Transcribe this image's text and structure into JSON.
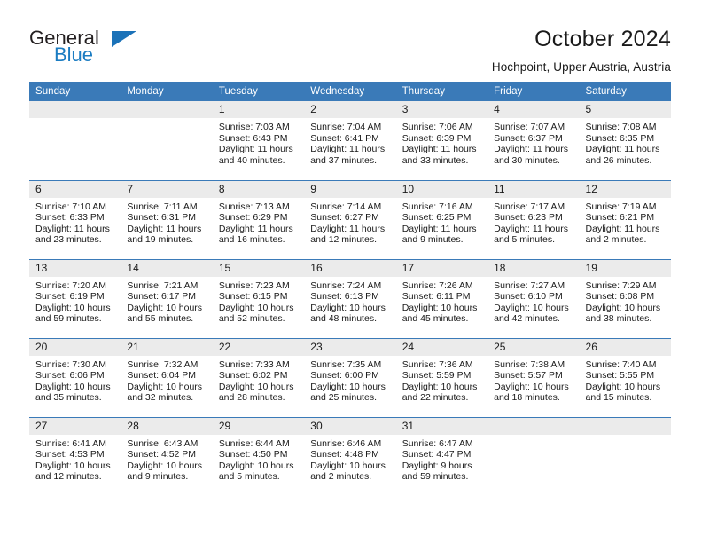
{
  "brand": {
    "word_one": "General",
    "word_two": "Blue",
    "triangle_icon": "brand-triangle-icon",
    "color_blue": "#1b7cc2",
    "color_dark": "#231f20"
  },
  "header": {
    "title": "October 2024",
    "subtitle": "Hochpoint, Upper Austria, Austria"
  },
  "theme": {
    "header_blue": "#3a7ab8",
    "daynum_gray": "#ebebeb",
    "text": "#1a1a1a"
  },
  "calendar": {
    "weekday_headers": [
      "Sunday",
      "Monday",
      "Tuesday",
      "Wednesday",
      "Thursday",
      "Friday",
      "Saturday"
    ],
    "weeks": [
      [
        {
          "day": "",
          "sunrise": "",
          "sunset": "",
          "daylight": "",
          "empty": true
        },
        {
          "day": "",
          "sunrise": "",
          "sunset": "",
          "daylight": "",
          "empty": true
        },
        {
          "day": "1",
          "sunrise": "Sunrise: 7:03 AM",
          "sunset": "Sunset: 6:43 PM",
          "daylight": "Daylight: 11 hours and 40 minutes."
        },
        {
          "day": "2",
          "sunrise": "Sunrise: 7:04 AM",
          "sunset": "Sunset: 6:41 PM",
          "daylight": "Daylight: 11 hours and 37 minutes."
        },
        {
          "day": "3",
          "sunrise": "Sunrise: 7:06 AM",
          "sunset": "Sunset: 6:39 PM",
          "daylight": "Daylight: 11 hours and 33 minutes."
        },
        {
          "day": "4",
          "sunrise": "Sunrise: 7:07 AM",
          "sunset": "Sunset: 6:37 PM",
          "daylight": "Daylight: 11 hours and 30 minutes."
        },
        {
          "day": "5",
          "sunrise": "Sunrise: 7:08 AM",
          "sunset": "Sunset: 6:35 PM",
          "daylight": "Daylight: 11 hours and 26 minutes."
        }
      ],
      [
        {
          "day": "6",
          "sunrise": "Sunrise: 7:10 AM",
          "sunset": "Sunset: 6:33 PM",
          "daylight": "Daylight: 11 hours and 23 minutes."
        },
        {
          "day": "7",
          "sunrise": "Sunrise: 7:11 AM",
          "sunset": "Sunset: 6:31 PM",
          "daylight": "Daylight: 11 hours and 19 minutes."
        },
        {
          "day": "8",
          "sunrise": "Sunrise: 7:13 AM",
          "sunset": "Sunset: 6:29 PM",
          "daylight": "Daylight: 11 hours and 16 minutes."
        },
        {
          "day": "9",
          "sunrise": "Sunrise: 7:14 AM",
          "sunset": "Sunset: 6:27 PM",
          "daylight": "Daylight: 11 hours and 12 minutes."
        },
        {
          "day": "10",
          "sunrise": "Sunrise: 7:16 AM",
          "sunset": "Sunset: 6:25 PM",
          "daylight": "Daylight: 11 hours and 9 minutes."
        },
        {
          "day": "11",
          "sunrise": "Sunrise: 7:17 AM",
          "sunset": "Sunset: 6:23 PM",
          "daylight": "Daylight: 11 hours and 5 minutes."
        },
        {
          "day": "12",
          "sunrise": "Sunrise: 7:19 AM",
          "sunset": "Sunset: 6:21 PM",
          "daylight": "Daylight: 11 hours and 2 minutes."
        }
      ],
      [
        {
          "day": "13",
          "sunrise": "Sunrise: 7:20 AM",
          "sunset": "Sunset: 6:19 PM",
          "daylight": "Daylight: 10 hours and 59 minutes."
        },
        {
          "day": "14",
          "sunrise": "Sunrise: 7:21 AM",
          "sunset": "Sunset: 6:17 PM",
          "daylight": "Daylight: 10 hours and 55 minutes."
        },
        {
          "day": "15",
          "sunrise": "Sunrise: 7:23 AM",
          "sunset": "Sunset: 6:15 PM",
          "daylight": "Daylight: 10 hours and 52 minutes."
        },
        {
          "day": "16",
          "sunrise": "Sunrise: 7:24 AM",
          "sunset": "Sunset: 6:13 PM",
          "daylight": "Daylight: 10 hours and 48 minutes."
        },
        {
          "day": "17",
          "sunrise": "Sunrise: 7:26 AM",
          "sunset": "Sunset: 6:11 PM",
          "daylight": "Daylight: 10 hours and 45 minutes."
        },
        {
          "day": "18",
          "sunrise": "Sunrise: 7:27 AM",
          "sunset": "Sunset: 6:10 PM",
          "daylight": "Daylight: 10 hours and 42 minutes."
        },
        {
          "day": "19",
          "sunrise": "Sunrise: 7:29 AM",
          "sunset": "Sunset: 6:08 PM",
          "daylight": "Daylight: 10 hours and 38 minutes."
        }
      ],
      [
        {
          "day": "20",
          "sunrise": "Sunrise: 7:30 AM",
          "sunset": "Sunset: 6:06 PM",
          "daylight": "Daylight: 10 hours and 35 minutes."
        },
        {
          "day": "21",
          "sunrise": "Sunrise: 7:32 AM",
          "sunset": "Sunset: 6:04 PM",
          "daylight": "Daylight: 10 hours and 32 minutes."
        },
        {
          "day": "22",
          "sunrise": "Sunrise: 7:33 AM",
          "sunset": "Sunset: 6:02 PM",
          "daylight": "Daylight: 10 hours and 28 minutes."
        },
        {
          "day": "23",
          "sunrise": "Sunrise: 7:35 AM",
          "sunset": "Sunset: 6:00 PM",
          "daylight": "Daylight: 10 hours and 25 minutes."
        },
        {
          "day": "24",
          "sunrise": "Sunrise: 7:36 AM",
          "sunset": "Sunset: 5:59 PM",
          "daylight": "Daylight: 10 hours and 22 minutes."
        },
        {
          "day": "25",
          "sunrise": "Sunrise: 7:38 AM",
          "sunset": "Sunset: 5:57 PM",
          "daylight": "Daylight: 10 hours and 18 minutes."
        },
        {
          "day": "26",
          "sunrise": "Sunrise: 7:40 AM",
          "sunset": "Sunset: 5:55 PM",
          "daylight": "Daylight: 10 hours and 15 minutes."
        }
      ],
      [
        {
          "day": "27",
          "sunrise": "Sunrise: 6:41 AM",
          "sunset": "Sunset: 4:53 PM",
          "daylight": "Daylight: 10 hours and 12 minutes."
        },
        {
          "day": "28",
          "sunrise": "Sunrise: 6:43 AM",
          "sunset": "Sunset: 4:52 PM",
          "daylight": "Daylight: 10 hours and 9 minutes."
        },
        {
          "day": "29",
          "sunrise": "Sunrise: 6:44 AM",
          "sunset": "Sunset: 4:50 PM",
          "daylight": "Daylight: 10 hours and 5 minutes."
        },
        {
          "day": "30",
          "sunrise": "Sunrise: 6:46 AM",
          "sunset": "Sunset: 4:48 PM",
          "daylight": "Daylight: 10 hours and 2 minutes."
        },
        {
          "day": "31",
          "sunrise": "Sunrise: 6:47 AM",
          "sunset": "Sunset: 4:47 PM",
          "daylight": "Daylight: 9 hours and 59 minutes."
        },
        {
          "day": "",
          "sunrise": "",
          "sunset": "",
          "daylight": "",
          "empty": true
        },
        {
          "day": "",
          "sunrise": "",
          "sunset": "",
          "daylight": "",
          "empty": true
        }
      ]
    ]
  }
}
